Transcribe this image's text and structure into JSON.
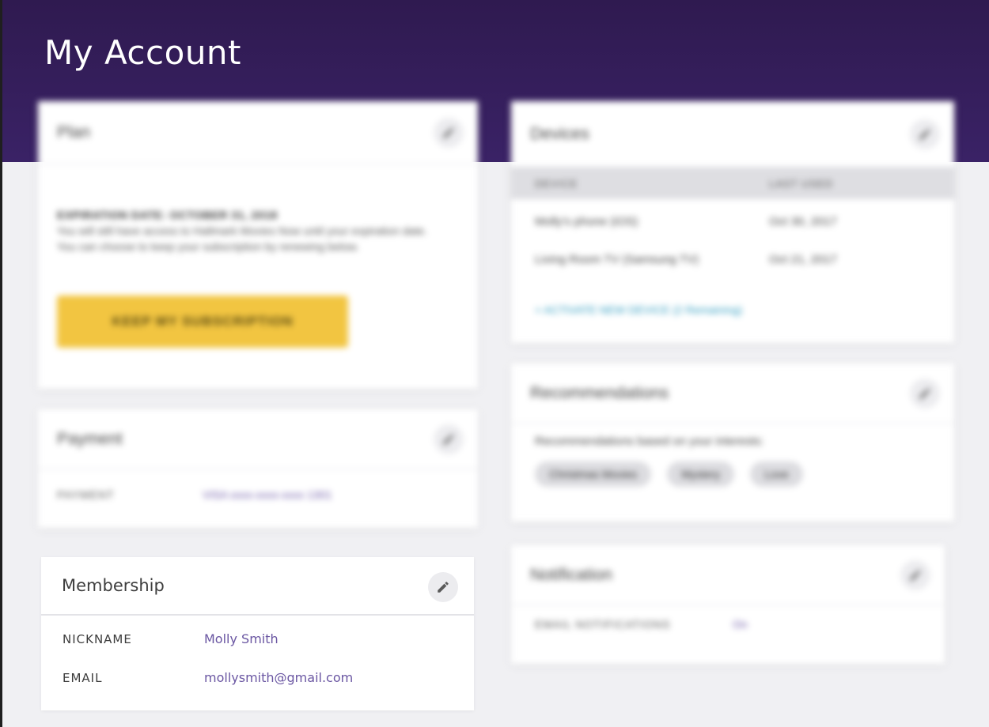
{
  "page_title": "My Account",
  "plan": {
    "title": "Plan",
    "expiry_label": "EXPIRATION DATE: OCTOBER 31, 2018",
    "expiry_text": "You will still have access to Hallmark Movies Now until your expiration date. You can choose to keep your subscription by renewing below.",
    "cta": "KEEP MY SUBSCRIPTION"
  },
  "payment": {
    "title": "Payment",
    "label": "PAYMENT",
    "value": "VISA xxxx-xxxx-xxxx 1301"
  },
  "devices": {
    "title": "Devices",
    "columns": [
      "DEVICE",
      "LAST USED"
    ],
    "rows": [
      [
        "Molly's phone (iOS)",
        "Oct 30, 2017"
      ],
      [
        "Living Room TV (Samsung TV)",
        "Oct 21, 2017"
      ]
    ],
    "link": "+ ACTIVATE NEW DEVICE (2 Remaining)"
  },
  "recommendations": {
    "title": "Recommendations",
    "intro": "Recommendations based on your interests:",
    "chips": [
      "Christmas Movies",
      "Mystery",
      "Love"
    ]
  },
  "notification": {
    "title": "Notification",
    "label": "EMAIL NOTIFICATIONS",
    "value": "On"
  },
  "membership": {
    "title": "Membership",
    "nickname_label": "NICKNAME",
    "nickname_value": "Molly Smith",
    "email_label": "EMAIL",
    "email_value": "mollysmith@gmail.com"
  }
}
